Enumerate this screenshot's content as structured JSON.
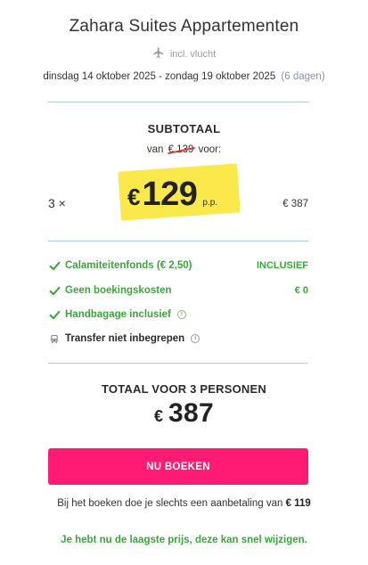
{
  "hotel": {
    "name": "Zahara Suites Appartementen",
    "flight_icon": "airplane-icon",
    "flight_text": "incl. vlucht",
    "dates": "dinsdag 14 oktober 2025 - zondag 19 oktober 2025",
    "duration": "(6 dagen)"
  },
  "subtotal": {
    "label": "SUBTOTAAL",
    "was_prefix": "van",
    "old_price": "€ 139",
    "was_suffix": "voor:",
    "quantity": "3 ×",
    "currency": "€",
    "price": "129",
    "per_person": "p.p.",
    "line_total": "€ 387",
    "highlight_color": "#fbe84a"
  },
  "features": [
    {
      "icon": "check-icon",
      "label": "Calamiteitenfonds (€ 2,50)",
      "value": "INCLUSIEF",
      "info": false,
      "style": "green"
    },
    {
      "icon": "check-icon",
      "label": "Geen boekingskosten",
      "value": "€ 0",
      "info": false,
      "style": "green"
    },
    {
      "icon": "check-icon",
      "label": "Handbagage inclusief",
      "value": "",
      "info": true,
      "style": "green"
    },
    {
      "icon": "bus-icon",
      "label": "Transfer niet inbegrepen",
      "value": "",
      "info": true,
      "style": "dark"
    }
  ],
  "total": {
    "label": "TOTAAL VOOR 3 PERSONEN",
    "currency": "€",
    "amount": "387"
  },
  "book_button": {
    "label": "NU BOEKEN",
    "color": "#ff1a73"
  },
  "deposit": {
    "text": "Bij het boeken doe je slechts een aanbetaling van",
    "amount": "€ 119"
  },
  "notice": "Je hebt nu de laagste prijs, deze kan snel wijzigen.",
  "colors": {
    "accent_green": "#3aa63a",
    "divider": "#a9ccd8"
  }
}
